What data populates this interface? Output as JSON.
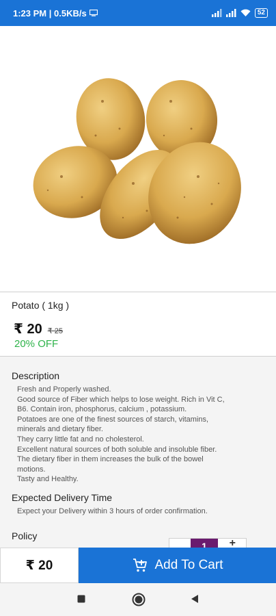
{
  "status_bar": {
    "time_speed": "1:23 PM | 0.5KB/s",
    "battery": "52"
  },
  "product": {
    "name": "Potato ( 1kg )",
    "price": "₹ 20",
    "mrp": "₹ 25",
    "discount": "20% OFF",
    "image_alt": "potatoes"
  },
  "description": {
    "title": "Description",
    "lines": [
      "Fresh and Properly washed.",
      "Good source of Fiber which helps to lose weight. Rich in Vit C,",
      "B6. Contain iron, phosphorus, calcium , potassium.",
      "Potatoes are one of the finest sources of starch, vitamins,",
      "minerals and dietary fiber.",
      "They carry little fat and no cholesterol.",
      "Excellent natural sources of both soluble and insoluble fiber.",
      "The dietary fiber in them increases the bulk of the bowel",
      "motions.",
      "Tasty and Healthy."
    ]
  },
  "delivery": {
    "title": "Expected Delivery Time",
    "text": "Expect your Delivery within 3 hours of order confirmation."
  },
  "policy": {
    "title": "Policy"
  },
  "quantity": {
    "value": "1",
    "plus": "+"
  },
  "bottom_bar": {
    "total": "₹ 20",
    "add_to_cart_label": "Add To Cart"
  },
  "colors": {
    "primary": "#1a73d6",
    "discount": "#2eb34a",
    "qty_bg": "#6a1b6e"
  },
  "icons": {
    "cart": "add-cart-icon",
    "nav_recent": "square-icon",
    "nav_home": "circle-icon",
    "nav_back": "triangle-icon"
  }
}
